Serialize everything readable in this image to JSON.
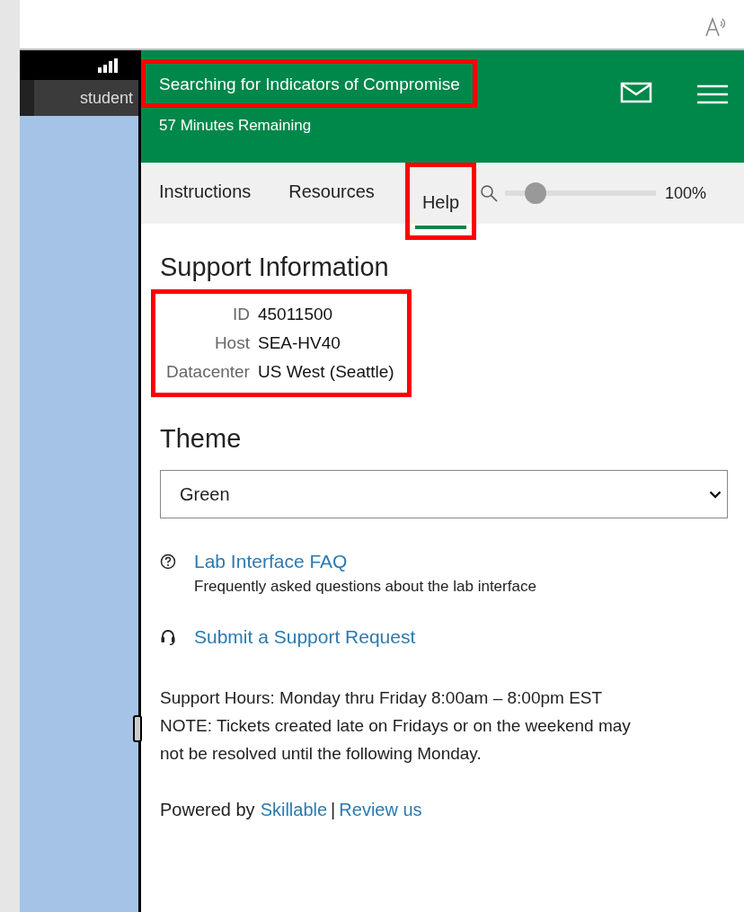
{
  "header": {
    "title": "Searching for Indicators of Compromise",
    "title_highlighted": true,
    "subtitle": "57 Minutes Remaining"
  },
  "sidebar": {
    "tab": "student"
  },
  "tabs": [
    {
      "label": "Instructions",
      "selected": false,
      "highlighted": false
    },
    {
      "label": "Resources",
      "selected": false,
      "highlighted": false
    },
    {
      "label": "Help",
      "selected": true,
      "highlighted": true
    }
  ],
  "zoom": {
    "level": 0.2,
    "reading": "100%"
  },
  "support": {
    "heading": "Support Information",
    "highlighted": true,
    "rows": [
      {
        "label": "ID",
        "value": "45011500"
      },
      {
        "label": "Host",
        "value": "SEA-HV40"
      },
      {
        "label": "Datacenter",
        "value": "US West (Seattle)"
      }
    ]
  },
  "theme": {
    "heading": "Theme",
    "value": "Green"
  },
  "links": [
    {
      "kind": "faq",
      "label": "Lab Interface FAQ",
      "description": "Frequently asked questions about the lab interface"
    },
    {
      "kind": "support",
      "label": "Submit a Support Request"
    }
  ],
  "notes": [
    "Support Hours: Monday thru Friday 8:00am – 8:00pm EST",
    "NOTE: Tickets created late on Fridays or on the weekend may not be resolved until the following Monday."
  ],
  "footer": {
    "prefix": "Powered by",
    "link_1": "Skillable",
    "separator": "|",
    "link_2": "Review us"
  }
}
